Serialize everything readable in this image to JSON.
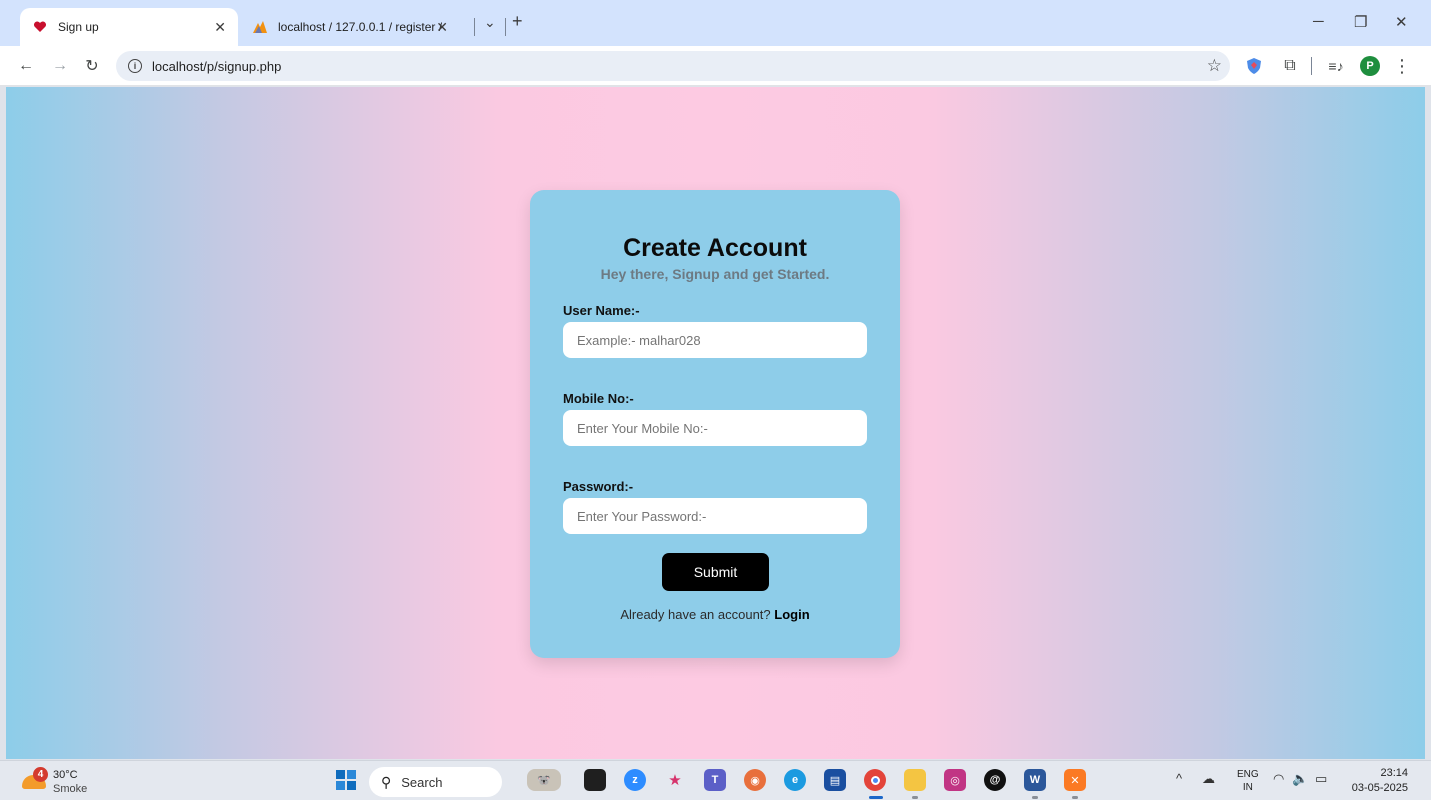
{
  "browser": {
    "tabs": [
      {
        "title": "Sign up",
        "active": true
      },
      {
        "title": "localhost / 127.0.0.1 / register /",
        "active": false
      }
    ],
    "url": "localhost/p/signup.php",
    "profile_initial": "P"
  },
  "form": {
    "title": "Create Account",
    "subtitle": "Hey there, Signup and get Started.",
    "username_label": "User Name:-",
    "username_placeholder": "Example:- malhar028",
    "mobile_label": "Mobile No:-",
    "mobile_placeholder": "Enter Your Mobile No:-",
    "password_label": "Password:-",
    "password_placeholder": "Enter Your Password:-",
    "submit_label": "Submit",
    "login_prompt": "Already have an account?",
    "login_link": "Login"
  },
  "colors": {
    "card": "#8ecde9",
    "button": "#000000",
    "gradient_edge": "#8dcde9",
    "gradient_center": "#fdcae2"
  },
  "taskbar": {
    "weather_badge": "4",
    "temperature": "30°C",
    "condition": "Smoke",
    "search_label": "Search",
    "lang_top": "ENG",
    "lang_bottom": "IN",
    "time": "23:14",
    "date": "03-05-2025"
  }
}
